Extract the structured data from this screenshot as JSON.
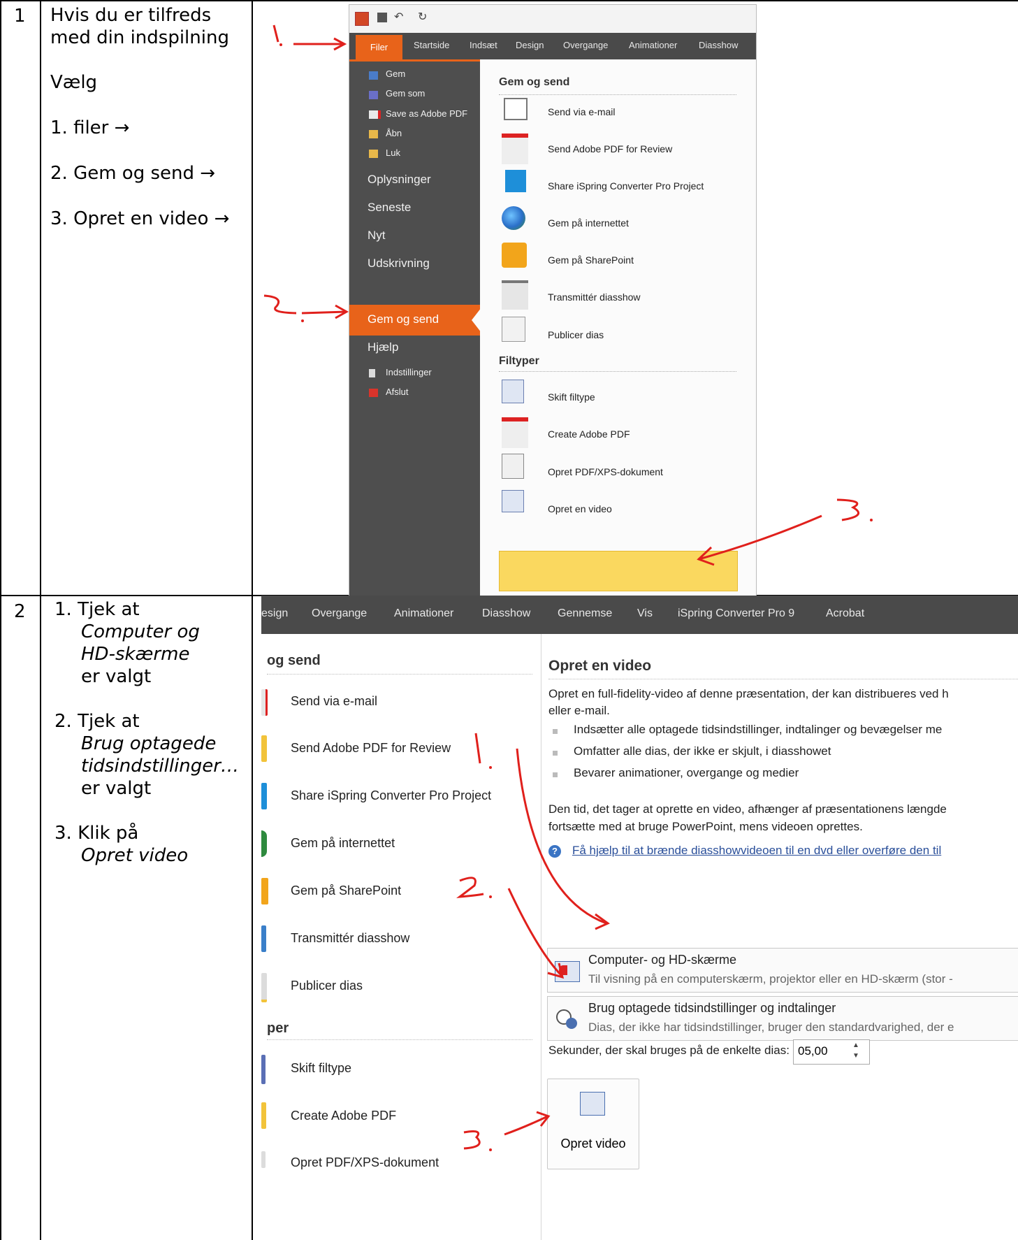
{
  "rows": [
    {
      "num": "1",
      "instructions": {
        "intro_line1": "Hvis du er tilfreds",
        "intro_line2": "med din indspilning",
        "choose": "Vælg",
        "steps": [
          "1. filer →",
          "2. Gem og send →",
          "3. Opret en video →"
        ]
      }
    },
    {
      "num": "2",
      "instructions": {
        "s1_num": "1.",
        "s1_a": "Tjek at",
        "s1_b": "Computer og",
        "s1_c": "HD-skærme",
        "s1_d": "er valgt",
        "s2_num": "2.",
        "s2_a": "Tjek at",
        "s2_b": "Brug optagede",
        "s2_c": "tidsindstillinger…",
        "s2_d": "er valgt",
        "s3_num": "3.",
        "s3_a": "Klik på",
        "s3_b": "Opret video"
      }
    }
  ],
  "screenshot1": {
    "tabs": [
      "Filer",
      "Startside",
      "Indsæt",
      "Design",
      "Overgange",
      "Animationer",
      "Diasshow"
    ],
    "left_small": [
      "Gem",
      "Gem som",
      "Save as Adobe PDF",
      "Åbn",
      "Luk"
    ],
    "left_big": [
      "Oplysninger",
      "Seneste",
      "Nyt",
      "Udskrivning",
      "Gem og send",
      "Hjælp"
    ],
    "left_bottom": [
      "Indstillinger",
      "Afslut"
    ],
    "section1": "Gem og send",
    "items1": [
      "Send via e-mail",
      "Send Adobe PDF for Review",
      "Share iSpring Converter Pro Project",
      "Gem på internettet",
      "Gem på SharePoint",
      "Transmittér diasshow",
      "Publicer dias"
    ],
    "section2": "Filtyper",
    "items2": [
      "Skift filtype",
      "Create Adobe PDF",
      "Opret PDF/XPS-dokument",
      "Opret en video"
    ],
    "annotations": [
      "1.",
      "2.",
      "3."
    ]
  },
  "screenshot2": {
    "tabs": [
      "esign",
      "Overgange",
      "Animationer",
      "Diasshow",
      "Gennemse",
      "Vis",
      "iSpring Converter Pro 9",
      "Acrobat"
    ],
    "left_head1": "og send",
    "left_items": [
      "Send via e-mail",
      "Send Adobe PDF for Review",
      "Share iSpring Converter Pro Project",
      "Gem på internettet",
      "Gem på SharePoint",
      "Transmittér diasshow",
      "Publicer dias"
    ],
    "left_head2": "per",
    "left_items2": [
      "Skift filtype",
      "Create Adobe PDF",
      "Opret PDF/XPS-dokument"
    ],
    "title": "Opret en video",
    "desc1": "Opret en full-fidelity-video af denne præsentation, der kan distribueres ved h",
    "desc2": "eller e-mail.",
    "bullets": [
      "Indsætter alle optagede tidsindstillinger, indtalinger og bevægelser me",
      "Omfatter alle dias, der ikke er skjult, i diasshowet",
      "Bevarer animationer, overgange og medier"
    ],
    "para1": "Den tid, det tager at oprette en video, afhænger af præsentationens længde",
    "para2": "fortsætte med at bruge PowerPoint, mens videoen oprettes.",
    "help_link": "Få hjælp til at brænde diasshowvideoen til en dvd eller overføre den til",
    "opt1_title": "Computer- og HD-skærme",
    "opt1_sub": "Til visning på en computerskærm, projektor eller en HD-skærm (stor -",
    "opt2_title": "Brug optagede tidsindstillinger og indtalinger",
    "opt2_sub": "Dias, der ikke har tidsindstillinger, bruger den standardvarighed, der e",
    "seconds_label": "Sekunder, der skal bruges på de enkelte dias:",
    "seconds_value": "05,00",
    "button": "Opret video",
    "annotations": [
      "1.",
      "2.",
      "3."
    ]
  },
  "colors": {
    "accent": "#e8631a",
    "ribbon": "#4a4a4a",
    "highlight": "#fad85f",
    "ink": "#e0201c"
  }
}
